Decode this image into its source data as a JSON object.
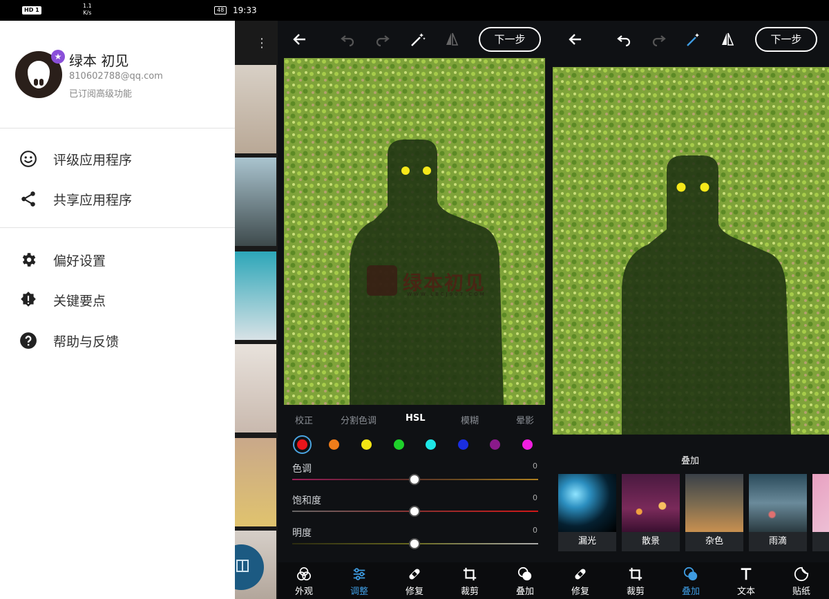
{
  "status_bar": {
    "hd_badge": "HD 1",
    "net_speed_value": "1.1",
    "net_speed_unit": "K/s",
    "battery": "48",
    "time": "19:33"
  },
  "drawer": {
    "username": "绿本 初见",
    "email": "810602788@qq.com",
    "subscription": "已订阅高级功能",
    "menu_group1": [
      {
        "label": "评级应用程序",
        "icon": "smiley-icon"
      },
      {
        "label": "共享应用程序",
        "icon": "share-icon"
      }
    ],
    "menu_group2": [
      {
        "label": "偏好设置",
        "icon": "gear-icon"
      },
      {
        "label": "关键要点",
        "icon": "alert-badge-icon"
      },
      {
        "label": "帮助与反馈",
        "icon": "help-icon"
      }
    ]
  },
  "editor_left": {
    "next_label": "下一步",
    "watermark_text": "绿本初见",
    "watermark_url": "WWW.LBCJ907.COM",
    "tabs": [
      "校正",
      "分割色调",
      "HSL",
      "模糊",
      "晕影"
    ],
    "active_tab": "HSL",
    "hsl_colors": [
      "#e8151b",
      "#f07d1a",
      "#f2e414",
      "#1ed12a",
      "#1ee6e6",
      "#1a2ee0",
      "#8a1a8a",
      "#f01ee0"
    ],
    "selected_color": "#e8151b",
    "sliders": [
      {
        "label": "色调",
        "value": "0"
      },
      {
        "label": "饱和度",
        "value": "0"
      },
      {
        "label": "明度",
        "value": "0"
      }
    ],
    "nav": [
      {
        "label": "外观",
        "icon": "looks-icon"
      },
      {
        "label": "调整",
        "icon": "sliders-icon"
      },
      {
        "label": "修复",
        "icon": "bandage-icon"
      },
      {
        "label": "裁剪",
        "icon": "crop-icon"
      },
      {
        "label": "叠加",
        "icon": "overlay-icon"
      }
    ],
    "active_nav": "调整"
  },
  "editor_right": {
    "next_label": "下一步",
    "overlay_title": "叠加",
    "overlays": [
      {
        "label": "漏光"
      },
      {
        "label": "散景"
      },
      {
        "label": "杂色"
      },
      {
        "label": "雨滴"
      }
    ],
    "nav": [
      {
        "label": "修复",
        "icon": "bandage-icon"
      },
      {
        "label": "裁剪",
        "icon": "crop-icon"
      },
      {
        "label": "叠加",
        "icon": "overlay-icon"
      },
      {
        "label": "文本",
        "icon": "text-icon"
      },
      {
        "label": "贴纸",
        "icon": "sticker-icon"
      }
    ],
    "active_nav": "叠加"
  },
  "colors": {
    "accent": "#3e9be0",
    "panel_bg": "#0f1114"
  }
}
